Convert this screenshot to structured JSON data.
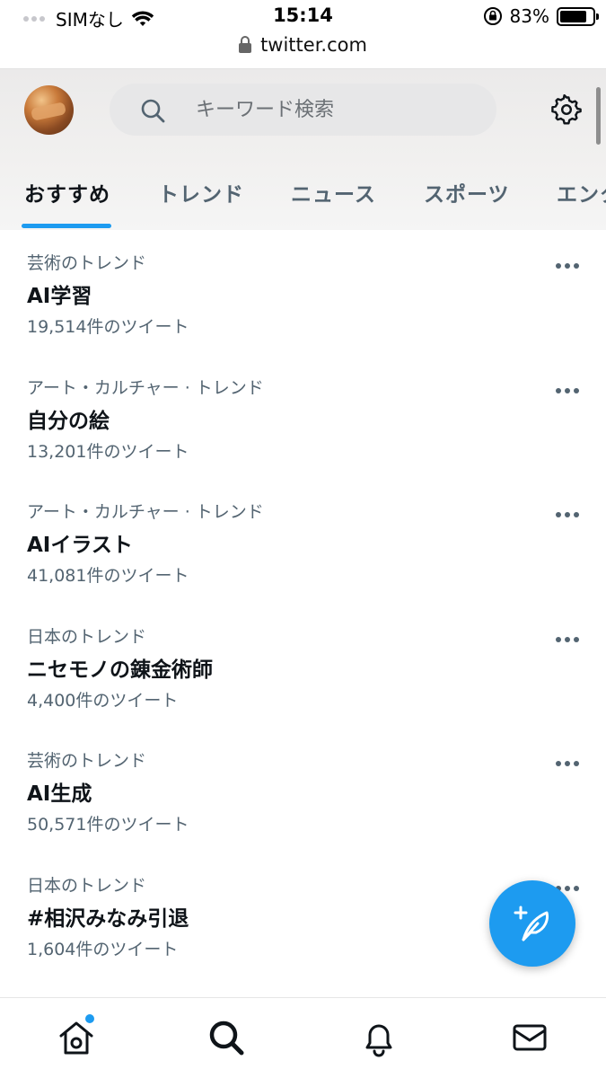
{
  "status_bar": {
    "carrier": "SIMなし",
    "time": "15:14",
    "battery_percent_text": "83%",
    "battery_level": 0.83
  },
  "browser": {
    "url": "twitter.com"
  },
  "header": {
    "search_placeholder": "キーワード検索",
    "tabs": [
      {
        "label": "おすすめ",
        "active": true
      },
      {
        "label": "トレンド",
        "active": false
      },
      {
        "label": "ニュース",
        "active": false
      },
      {
        "label": "スポーツ",
        "active": false
      },
      {
        "label": "エンタ",
        "active": false
      }
    ]
  },
  "trends": [
    {
      "category": "芸術のトレンド",
      "name": "AI学習",
      "count": "19,514件のツイート"
    },
    {
      "category": "アート・カルチャー · トレンド",
      "name": "自分の絵",
      "count": "13,201件のツイート"
    },
    {
      "category": "アート・カルチャー · トレンド",
      "name": "AIイラスト",
      "count": "41,081件のツイート"
    },
    {
      "category": "日本のトレンド",
      "name": "ニセモノの錬金術師",
      "count": "4,400件のツイート"
    },
    {
      "category": "芸術のトレンド",
      "name": "AI生成",
      "count": "50,571件のツイート"
    },
    {
      "category": "日本のトレンド",
      "name": "#相沢みなみ引退",
      "count": "1,604件のツイート"
    }
  ],
  "icons": {
    "wifi": "wifi-icon",
    "lock": "lock-icon",
    "orientation_lock": "orientation-lock-icon",
    "search": "search-icon",
    "settings": "gear-icon",
    "more": "more-icon",
    "compose": "compose-tweet-icon",
    "home": "home-icon",
    "explore": "search-icon",
    "notifications": "bell-icon",
    "messages": "mail-icon"
  },
  "colors": {
    "accent": "#1d9bf0",
    "secondary_text": "#536471",
    "primary_text": "#0f1419"
  }
}
